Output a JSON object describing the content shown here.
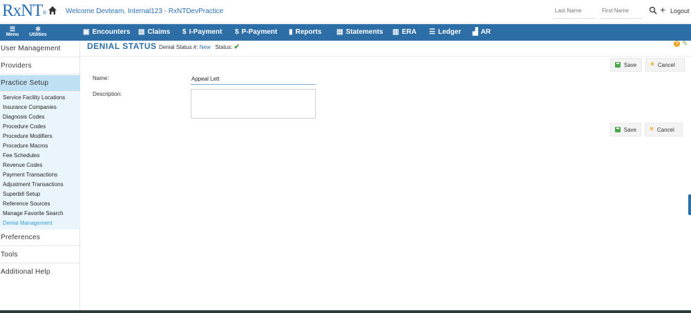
{
  "header": {
    "logo_text": "RxNT",
    "welcome": "Welcome  Devteam, Internal123 - RxNTDevPractice",
    "last_name_placeholder": "Last Name",
    "first_name_placeholder": "First Name",
    "logout_label": "Logout",
    "accent_color": "#2d6ea7"
  },
  "nav": {
    "menu_label": "Menu",
    "utilities_label": "Utilities",
    "items": [
      {
        "label": "Encounters",
        "icon": "encounters-icon"
      },
      {
        "label": "Claims",
        "icon": "claims-icon"
      },
      {
        "label": "I-Payment",
        "icon": "dollar-icon"
      },
      {
        "label": "P-Payment",
        "icon": "dollar-icon"
      },
      {
        "label": "Reports",
        "icon": "reports-icon"
      },
      {
        "label": "Statements",
        "icon": "statements-icon"
      },
      {
        "label": "ERA",
        "icon": "era-icon"
      },
      {
        "label": "Ledger",
        "icon": "list-icon"
      },
      {
        "label": "AR",
        "icon": "bar-chart-icon"
      }
    ]
  },
  "sidebar": {
    "sections": {
      "user_management": "User Management",
      "providers": "Providers",
      "practice_setup": "Practice Setup",
      "preferences": "Preferences",
      "tools": "Tools",
      "additional_help": "Additional Help"
    },
    "practice_items": [
      "Service Facility Locations",
      "Insurance Companies",
      "Diagnosis Codes",
      "Procedure Codes",
      "Procedure Modifiers",
      "Procedure Macros",
      "Fee Schedules",
      "Revenue Codes",
      "Payment Transactions",
      "Adjustment Transactions",
      "Superbill Setup",
      "Reference Sources",
      "Manage Favorite Search",
      "Denial Management"
    ],
    "active_item": "Denial Management"
  },
  "main": {
    "title": "DENIAL STATUS",
    "status_number_label": "Denial Status #:",
    "status_number_value": "New",
    "status_label": "Status:",
    "form": {
      "name_label": "Name:",
      "name_value": "Appeal Lett",
      "description_label": "Description:",
      "description_value": ""
    },
    "save_label": "Save",
    "cancel_label": "Cancel"
  }
}
